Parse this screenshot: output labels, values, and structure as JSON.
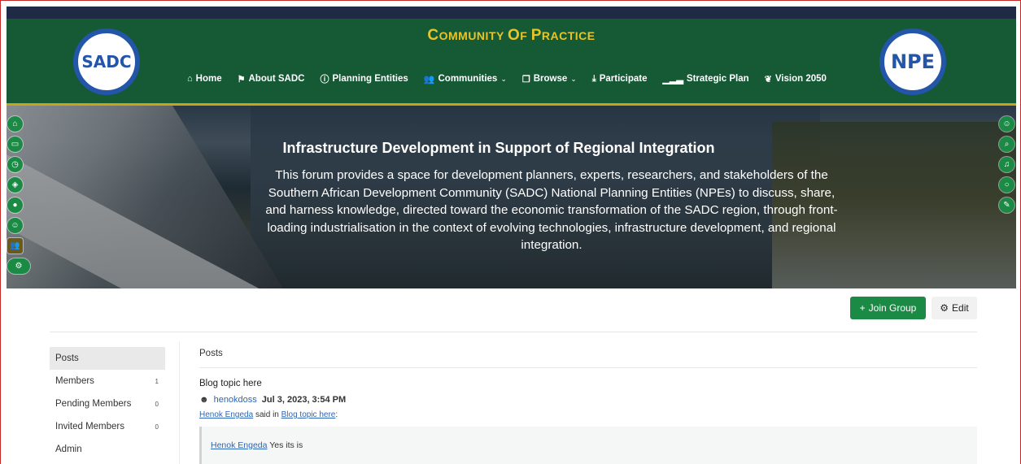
{
  "header": {
    "site_title_c": "C",
    "site_title_1": "OMMUNITY ",
    "site_title_o": "O",
    "site_title_2": "F ",
    "site_title_p": "P",
    "site_title_3": "RACTICE",
    "logo_left_text": "SADC",
    "logo_right_text": "NPE"
  },
  "nav": {
    "items": [
      {
        "label": "Home",
        "icon": "home-icon"
      },
      {
        "label": "About SADC",
        "icon": "flag-icon"
      },
      {
        "label": "Planning Entities",
        "icon": "info-icon"
      },
      {
        "label": "Communities",
        "icon": "users-icon"
      },
      {
        "label": "Browse",
        "icon": "browse-icon"
      },
      {
        "label": "Participate",
        "icon": "download-icon"
      },
      {
        "label": "Strategic Plan",
        "icon": "signal-icon"
      },
      {
        "label": "Vision 2050",
        "icon": "leaf-icon"
      }
    ]
  },
  "hero": {
    "title": "Infrastructure Development in Support of Regional Integration",
    "description": "This forum provides a space for development planners, experts, researchers, and stakeholders of the Southern African Development Community (SADC) National Planning Entities (NPEs) to discuss, share, and harness knowledge, directed toward the economic transformation of the SADC region, through front-loading industrialisation in the context of evolving technologies, infrastructure development, and regional integration."
  },
  "sidebar_left": [
    "home-icon",
    "inbox-icon",
    "clock-icon",
    "tag-icon",
    "fire-icon",
    "user-icon",
    "group-icon",
    "cogs-icon"
  ],
  "sidebar_right": [
    "avatar-icon",
    "search-icon",
    "bell-icon",
    "chat-icon",
    "compose-icon"
  ],
  "actions": {
    "join_label": "Join Group",
    "edit_label": "Edit"
  },
  "group_nav": {
    "items": [
      {
        "label": "Posts",
        "count": ""
      },
      {
        "label": "Members",
        "count": "1"
      },
      {
        "label": "Pending Members",
        "count": "0"
      },
      {
        "label": "Invited Members",
        "count": "0"
      },
      {
        "label": "Admin",
        "count": ""
      }
    ]
  },
  "posts": {
    "heading": "Posts",
    "post_title": "Blog topic here",
    "author": "henokdoss",
    "date": "Jul 3, 2023, 3:54 PM",
    "said_user": "Henok Engeda",
    "said_text": " said in ",
    "said_link": "Blog topic here",
    "said_colon": ":",
    "quote_user": "Henok Engeda",
    "quote_text": " Yes its is"
  },
  "colors": {
    "header_bg": "#155a34",
    "title_gold": "#e7c52a",
    "accent_green": "#1a8a45",
    "link_blue": "#2b66b8"
  }
}
